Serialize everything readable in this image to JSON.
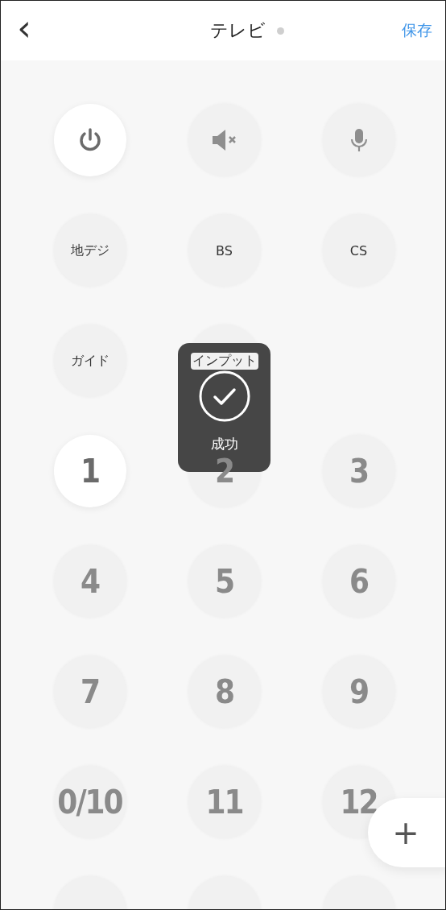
{
  "header": {
    "back": "‹",
    "title": "テレビ",
    "status_dot": true,
    "save": "保存"
  },
  "buttons": [
    {
      "kind": "power",
      "active": true
    },
    {
      "kind": "mute",
      "active": false
    },
    {
      "kind": "mic",
      "active": false
    },
    {
      "kind": "label",
      "label": "地デジ",
      "active": false
    },
    {
      "kind": "label",
      "label": "BS",
      "active": false
    },
    {
      "kind": "label",
      "label": "CS",
      "active": false
    },
    {
      "kind": "label",
      "label": "ガイド",
      "active": false
    },
    {
      "kind": "label",
      "label": "インプット",
      "active": false
    },
    {
      "kind": "empty"
    },
    {
      "kind": "number",
      "label": "1",
      "active": true
    },
    {
      "kind": "number",
      "label": "2",
      "active": false
    },
    {
      "kind": "number",
      "label": "3",
      "active": false
    },
    {
      "kind": "number",
      "label": "4",
      "active": false
    },
    {
      "kind": "number",
      "label": "5",
      "active": false
    },
    {
      "kind": "number",
      "label": "6",
      "active": false
    },
    {
      "kind": "number",
      "label": "7",
      "active": false
    },
    {
      "kind": "number",
      "label": "8",
      "active": false
    },
    {
      "kind": "number",
      "label": "9",
      "active": false
    },
    {
      "kind": "number",
      "label": "0/10",
      "active": false
    },
    {
      "kind": "number",
      "label": "11",
      "active": false
    },
    {
      "kind": "number",
      "label": "12",
      "active": false
    },
    {
      "kind": "blank",
      "active": false
    },
    {
      "kind": "blank",
      "active": false
    },
    {
      "kind": "blank",
      "active": false
    }
  ],
  "toast": {
    "message": "成功"
  },
  "add_button": "+"
}
